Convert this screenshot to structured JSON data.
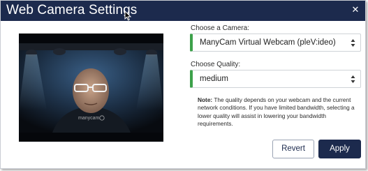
{
  "dialog": {
    "title": "Web Camera Settings",
    "close_icon": "close-icon"
  },
  "camera": {
    "label": "Choose a Camera:",
    "selected": "ManyCam Virtual Webcam (pleV:ideo)"
  },
  "quality": {
    "label": "Choose Quality:",
    "selected": "medium"
  },
  "note": {
    "prefix": "Note:",
    "text": "The quality depends on your webcam and the current network conditions. If you have limited bandwidth, selecting a lower quality will assist in lowering your bandwidth requirements."
  },
  "preview": {
    "watermark": "manycam"
  },
  "buttons": {
    "revert": "Revert",
    "apply": "Apply"
  },
  "colors": {
    "titlebar": "#1c2a4d",
    "accent_green": "#3ca14a",
    "apply_bg": "#1c2a4d"
  }
}
